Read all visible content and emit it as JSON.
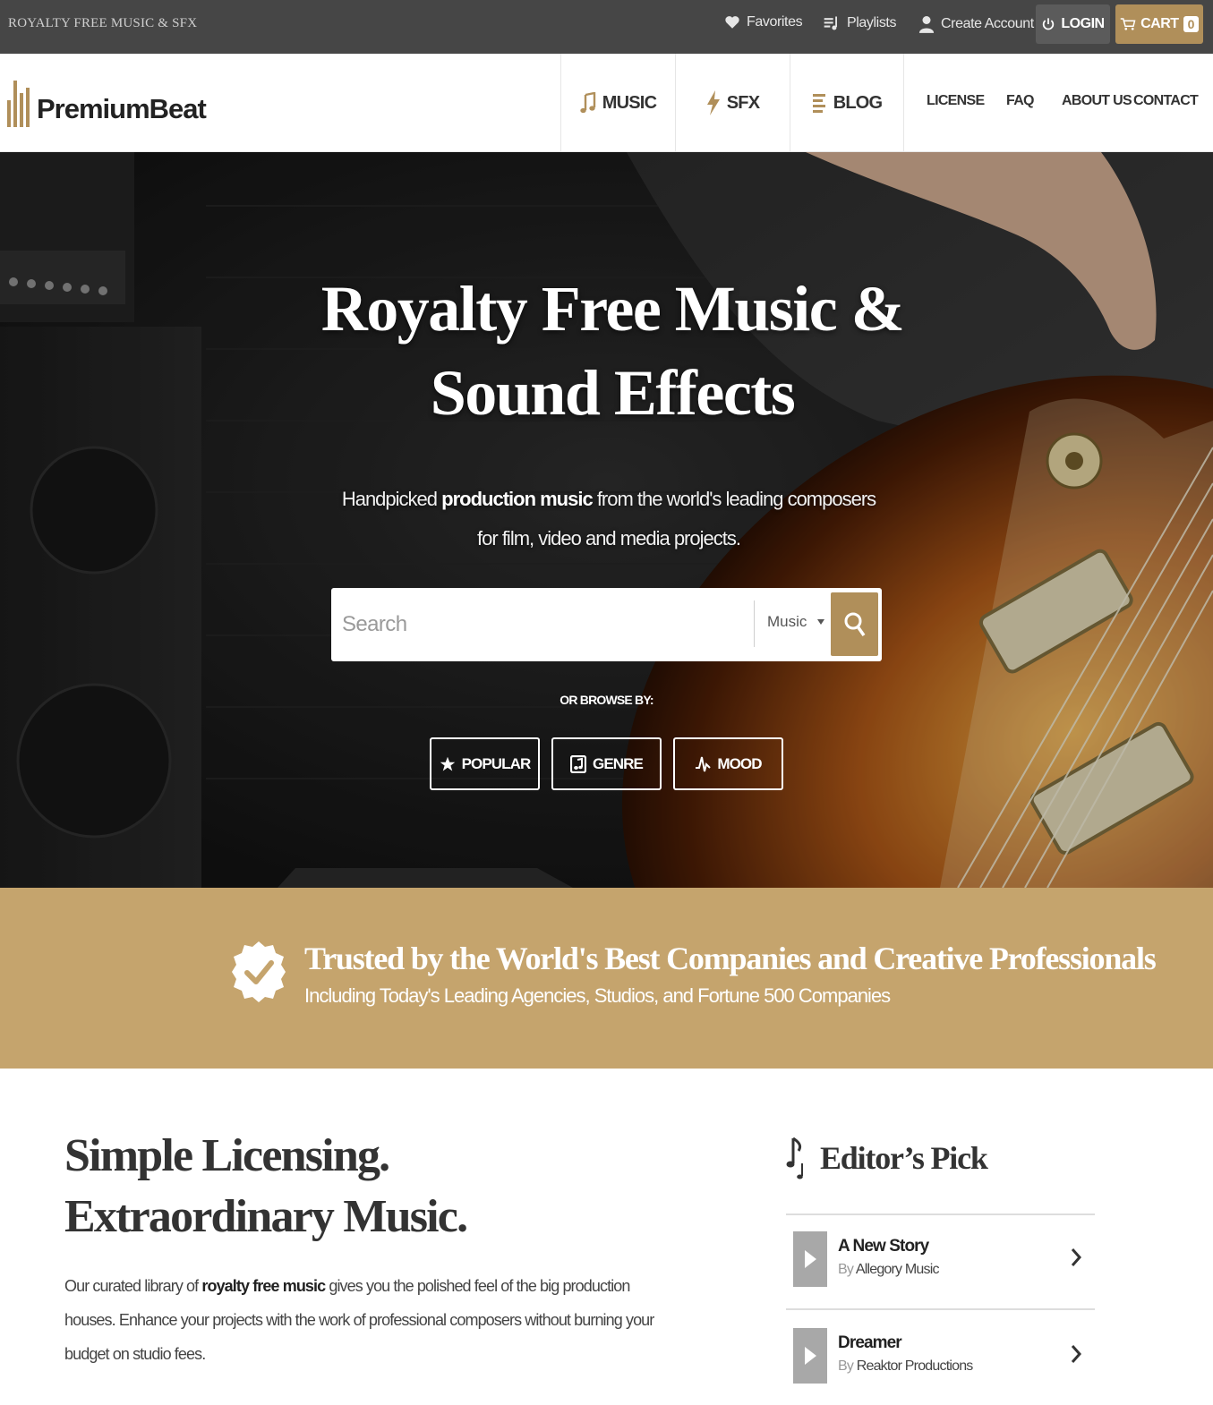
{
  "topbar": {
    "tagline": "ROYALTY FREE MUSIC & SFX",
    "favorites": "Favorites",
    "playlists": "Playlists",
    "create_account": "Create Account",
    "login": "LOGIN",
    "cart": "CART",
    "cart_count": "0"
  },
  "logo": {
    "text": "PremiumBeat"
  },
  "nav": {
    "music": "MUSIC",
    "sfx": "SFX",
    "blog": "BLOG",
    "license": "LICENSE",
    "faq": "FAQ",
    "about": "ABOUT US",
    "contact": "CONTACT"
  },
  "hero": {
    "title": "Royalty Free Music & Sound Effects",
    "subtitle_pre": "Handpicked ",
    "subtitle_bold": "production music",
    "subtitle_post": " from the world's leading composers",
    "subtitle_line2": "for film, video and media projects.",
    "search_placeholder": "Search",
    "search_category": "Music",
    "browse_label": "OR BROWSE BY:",
    "browse": [
      "POPULAR",
      "GENRE",
      "MOOD"
    ]
  },
  "trusted": {
    "title": "Trusted by the World's Best Companies and Creative Professionals",
    "subtitle": "Including Today's Leading Agencies, Studios, and Fortune 500 Companies"
  },
  "licensing": {
    "title_line1": "Simple Licensing.",
    "title_line2": "Extraordinary Music.",
    "body_pre": "Our curated library of ",
    "body_bold": "royalty free music",
    "body_post": " gives you the polished feel of the big production houses. Enhance your projects with the work of professional composers without burning your budget on studio fees."
  },
  "editors_pick": {
    "title": "Editor’s Pick",
    "tracks": [
      {
        "name": "A New Story",
        "by": "By",
        "artist": "Allegory Music"
      },
      {
        "name": "Dreamer",
        "by": "By",
        "artist": "Reaktor Productions"
      }
    ]
  },
  "colors": {
    "accent": "#b08f5a",
    "band": "#c5a46d",
    "topbar": "#464646"
  }
}
